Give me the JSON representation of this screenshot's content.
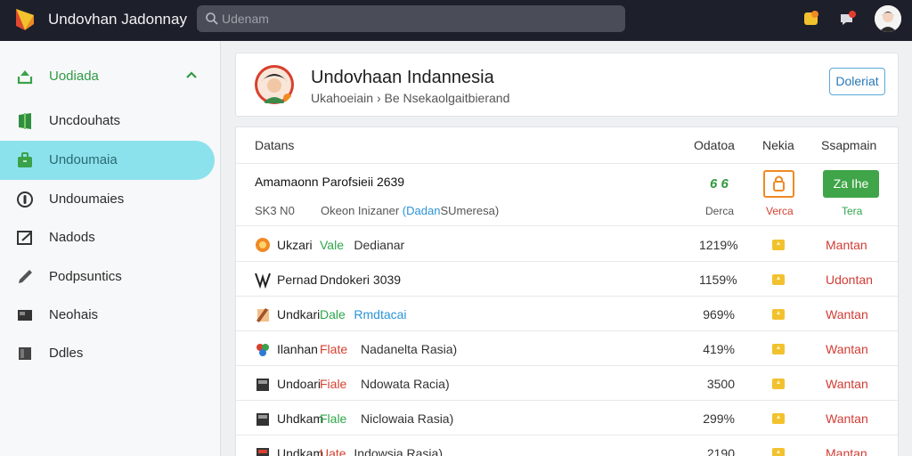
{
  "app": {
    "title": "Undovhan   Jadonnay"
  },
  "search": {
    "placeholder": "Udenam"
  },
  "sidebar": {
    "items": [
      {
        "label": "Uodiada",
        "icon": "upload-icon"
      },
      {
        "label": "Uncdouhats",
        "icon": "bookmark-icon"
      },
      {
        "label": "Undoumaia",
        "icon": "briefcase-icon"
      },
      {
        "label": "Undoumaies",
        "icon": "info-icon"
      },
      {
        "label": "Nadods",
        "icon": "edit-icon"
      },
      {
        "label": "Podpsuntics",
        "icon": "pencil-icon"
      },
      {
        "label": "Neohais",
        "icon": "monitor-icon"
      },
      {
        "label": "Ddles",
        "icon": "square-icon"
      }
    ]
  },
  "header": {
    "title": "Undovhaan Indannesia",
    "subtitle": "Ukahoeiain  ›  Be Nsekaolgaitbierand",
    "button": "Doleriat"
  },
  "table": {
    "columns": [
      "Datans",
      "Odatoa",
      "Nekia",
      "Ssapmain"
    ],
    "featured": {
      "title": "Amamaonn  Parofsieii 2639",
      "meta_label": "SK3 N0",
      "meta_text": "Okeon Inizaner",
      "meta_link": "(Dadan",
      "meta_rest": "SUmeresa)",
      "score": "6 6",
      "score_caption": "Derca",
      "nekia_caption": "Verca",
      "action_button": "Za Ihe",
      "action_caption": "Tera"
    },
    "rows": [
      {
        "icon": "orange-circle-icon",
        "t1": "Ukzari",
        "t2": "Vale",
        "t2_color": "green",
        "t3": "Dedianar",
        "pct": "1219%",
        "status": "Mantan"
      },
      {
        "icon": "tree-icon",
        "t1": "Pernad",
        "t2": "Dndokeri 3039",
        "t2_color": "plain",
        "t3": "",
        "pct": "1159%",
        "status": "Udontan"
      },
      {
        "icon": "notebook-icon",
        "t1": "Undkari",
        "t2": "Dale",
        "t2_color": "green",
        "t3": "Rmdtacai",
        "pct": "969%",
        "status": "Wantan"
      },
      {
        "icon": "flower-icon",
        "t1": "Ilanhan",
        "t2": "Flate",
        "t2_color": "red",
        "t3": "Nadanelta Rasia)",
        "pct": "419%",
        "status": "Wantan"
      },
      {
        "icon": "book-icon",
        "t1": "Undoari",
        "t2": "Fiale",
        "t2_color": "red",
        "t3": "Ndowata Racia)",
        "pct": "3500",
        "status": "Wantan"
      },
      {
        "icon": "book-icon",
        "t1": "Uhdkam",
        "t2": "Flale",
        "t2_color": "green",
        "t3": "Niclowaia Rasia)",
        "pct": "299%",
        "status": "Wantan"
      },
      {
        "icon": "book-red-icon",
        "t1": "Undkam",
        "t2": "Uate",
        "t2_color": "red",
        "t3": "Indowsia Rasia)",
        "pct": "2190",
        "status": "Mantan"
      }
    ]
  }
}
